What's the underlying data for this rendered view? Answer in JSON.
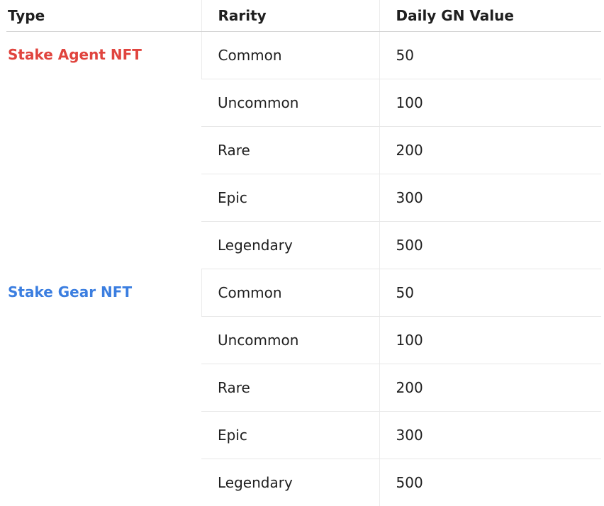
{
  "headers": {
    "type": "Type",
    "rarity": "Rarity",
    "value": "Daily GN Value"
  },
  "groups": [
    {
      "type": "Stake Agent NFT",
      "color": "#e0443e",
      "rows": [
        {
          "rarity": "Common",
          "value": "50"
        },
        {
          "rarity": "Uncommon",
          "value": "100"
        },
        {
          "rarity": "Rare",
          "value": "200"
        },
        {
          "rarity": "Epic",
          "value": "300"
        },
        {
          "rarity": "Legendary",
          "value": "500"
        }
      ]
    },
    {
      "type": "Stake Gear NFT",
      "color": "#3b7ee0",
      "rows": [
        {
          "rarity": "Common",
          "value": "50"
        },
        {
          "rarity": "Uncommon",
          "value": "100"
        },
        {
          "rarity": "Rare",
          "value": "200"
        },
        {
          "rarity": "Epic",
          "value": "300"
        },
        {
          "rarity": "Legendary",
          "value": "500"
        }
      ]
    }
  ]
}
